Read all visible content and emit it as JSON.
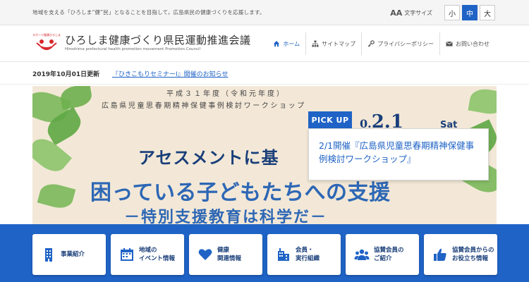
{
  "topbar": {
    "tagline": "地域を支える「ひろしま“健”民」となることを目指して，広島県民の健康づくりを応援します。",
    "font_size_icon": "AA",
    "font_size_label": "文字サイズ",
    "font_sizes": [
      "小",
      "中",
      "大"
    ],
    "font_size_selected": "中"
  },
  "header": {
    "title": "ひろしま健康づくり県民運動推進会議",
    "subtitle": "Hiroshima prefectural health promotion movement Promotion Council",
    "logo_text": "スポーツ健康ひろしま",
    "nav": [
      {
        "label": "ホーム",
        "icon": "home-icon",
        "active": true
      },
      {
        "label": "サイトマップ",
        "icon": "sitemap-icon",
        "active": false
      },
      {
        "label": "プライバシーポリシー",
        "icon": "key-icon",
        "active": false
      },
      {
        "label": "お問い合わせ",
        "icon": "mail-icon",
        "active": false
      }
    ]
  },
  "news": {
    "date": "2019年10月01日更新",
    "link": "『ひきこもりセミナーⅠ』開催のお知らせ"
  },
  "hero": {
    "line1": "平成３１年度（令和元年度）",
    "line2": "広島県児童思春期精神保健事例検討ワークショップ",
    "date": "2.1",
    "date_prefix": "0.",
    "dow": "Sat",
    "title1": "アセスメントに基",
    "title2": "困っている子どもたちへの支援",
    "title3": "－特別支援教育は科学だ－"
  },
  "pickup": {
    "tag": "PICK UP",
    "text": "2/1開催『広島県児童思春期精神保健事例検討ワークショップ』"
  },
  "cards": [
    {
      "label": "事業紹介",
      "icon": "building-icon"
    },
    {
      "label": "地域の\nイベント情報",
      "icon": "calendar-icon"
    },
    {
      "label": "健康\n関連情報",
      "icon": "heart-icon"
    },
    {
      "label": "会員・\n実行組織",
      "icon": "org-icon"
    },
    {
      "label": "協賛会員の\nご紹介",
      "icon": "group-icon"
    },
    {
      "label": "協賛会員からの\nお役立ち情報",
      "icon": "thumbs-up-icon"
    }
  ],
  "colors": {
    "primary": "#1f63c6",
    "dark_blue": "#1a3f7a",
    "hero_bg": "#f3e8d7",
    "logo_red": "#d8262b"
  }
}
